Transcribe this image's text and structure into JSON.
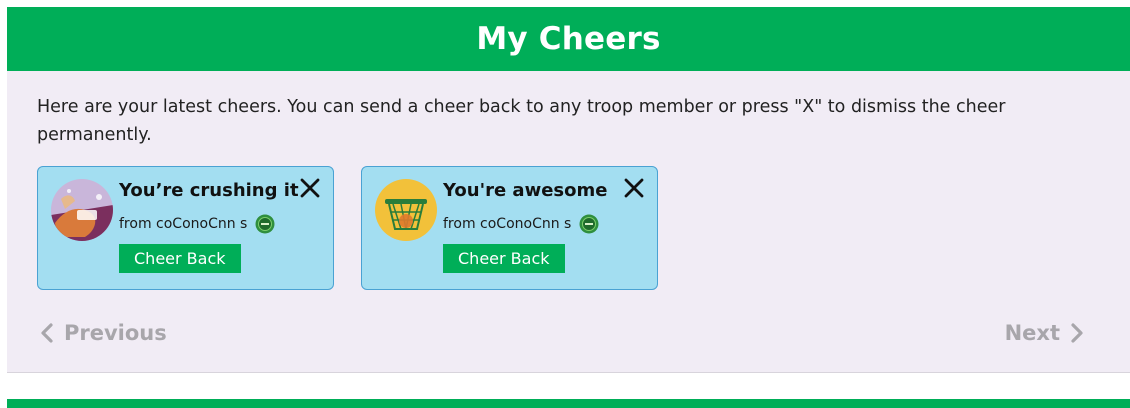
{
  "header": {
    "title": "My Cheers"
  },
  "intro": {
    "text": "Here are your latest cheers. You can send a cheer back to any troop member or press \"X\" to dismiss the cheer permanently."
  },
  "cheers": [
    {
      "title": "You’re crushing it",
      "from": "from coConoCnn s",
      "cheer_back_label": "Cheer Back",
      "avatar_icon": "crushing-it-illustration-icon"
    },
    {
      "title": "You're awesome",
      "from": "from coConoCnn s",
      "cheer_back_label": "Cheer Back",
      "avatar_icon": "basketball-hoop-icon"
    }
  ],
  "nav": {
    "previous_label": "Previous",
    "next_label": "Next"
  },
  "colors": {
    "brand_green": "#00ae58",
    "card_bg": "#a3def1",
    "card_border": "#4aa2d3",
    "panel_bg": "#f1ecf5",
    "nav_disabled": "#a8a6ab"
  }
}
